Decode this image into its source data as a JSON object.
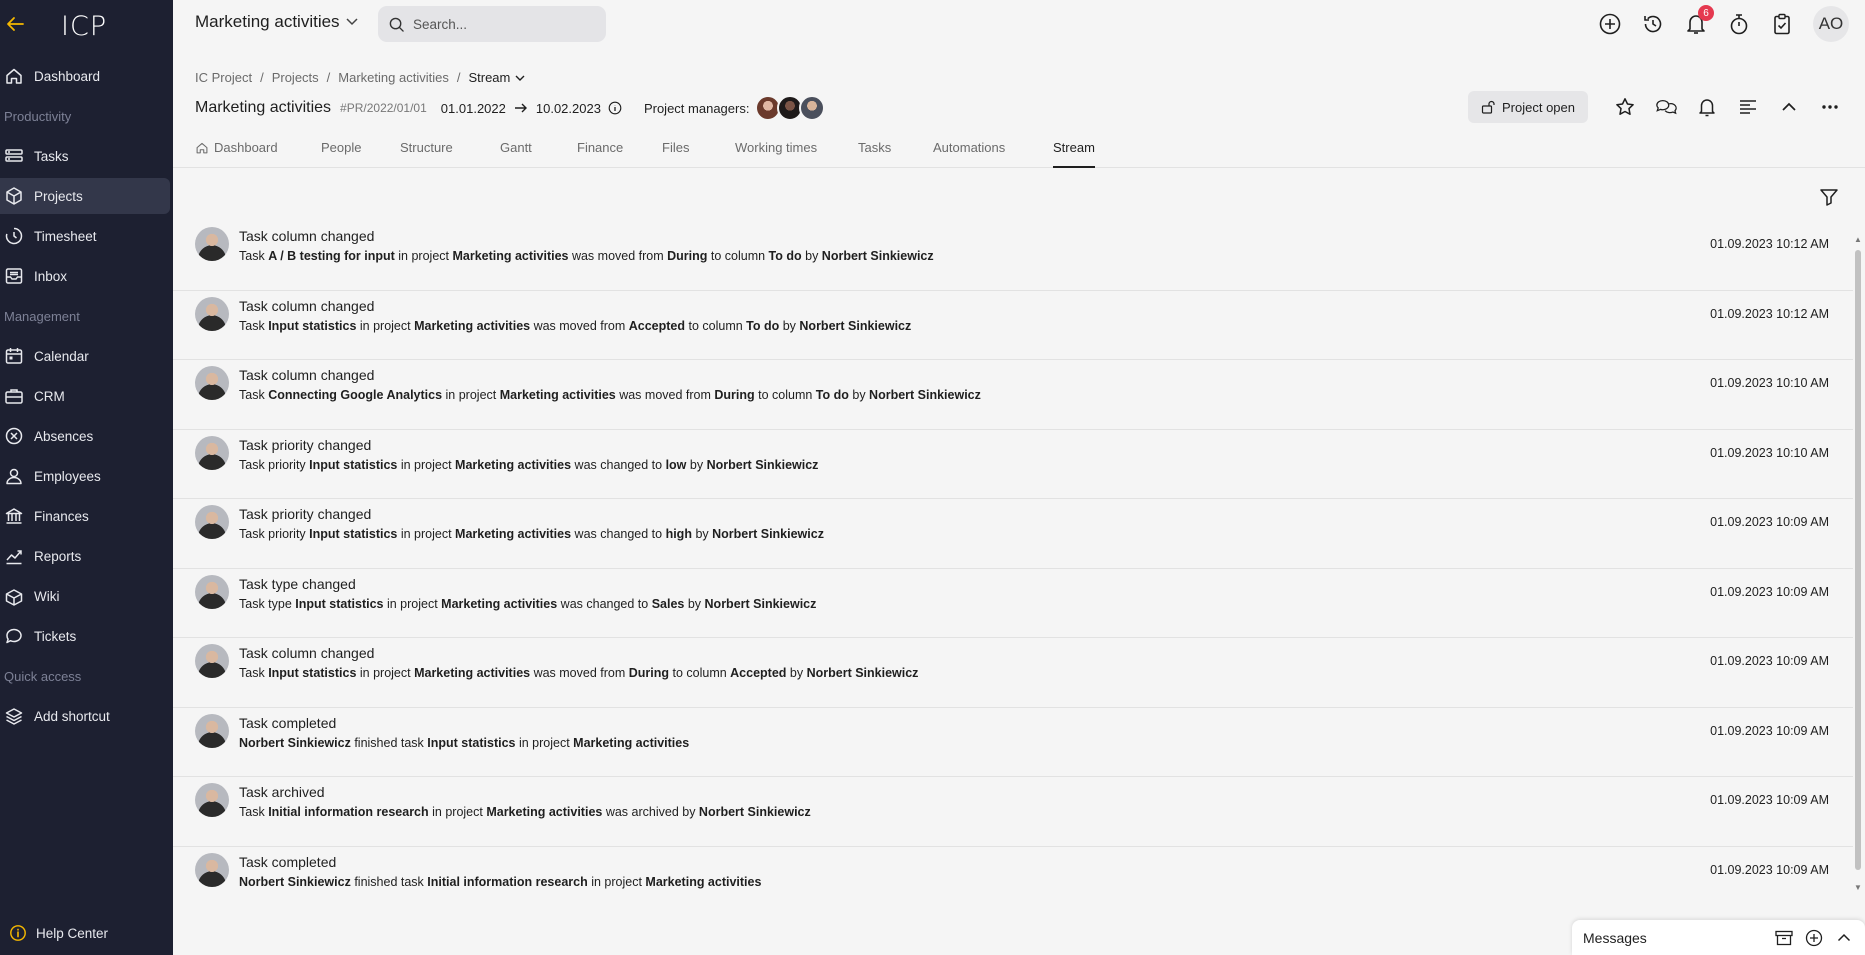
{
  "sidebar": {
    "logo": "ICP",
    "items": [
      {
        "type": "item",
        "label": "Dashboard",
        "icon": "home-icon"
      },
      {
        "type": "section",
        "label": "Productivity"
      },
      {
        "type": "item",
        "label": "Tasks",
        "icon": "tasks-icon"
      },
      {
        "type": "item",
        "label": "Projects",
        "icon": "cube-icon",
        "active": true
      },
      {
        "type": "item",
        "label": "Timesheet",
        "icon": "timesheet-icon"
      },
      {
        "type": "item",
        "label": "Inbox",
        "icon": "inbox-icon"
      },
      {
        "type": "section",
        "label": "Management"
      },
      {
        "type": "item",
        "label": "Calendar",
        "icon": "calendar-icon"
      },
      {
        "type": "item",
        "label": "CRM",
        "icon": "briefcase-icon"
      },
      {
        "type": "item",
        "label": "Absences",
        "icon": "x-circle-icon"
      },
      {
        "type": "item",
        "label": "Employees",
        "icon": "user-icon"
      },
      {
        "type": "item",
        "label": "Finances",
        "icon": "bank-icon"
      },
      {
        "type": "item",
        "label": "Reports",
        "icon": "chart-icon"
      },
      {
        "type": "item",
        "label": "Wiki",
        "icon": "wiki-icon"
      },
      {
        "type": "item",
        "label": "Tickets",
        "icon": "chat-icon"
      },
      {
        "type": "section",
        "label": "Quick access"
      },
      {
        "type": "item",
        "label": "Add shortcut",
        "icon": "layers-icon"
      }
    ],
    "help": "Help Center"
  },
  "topbar": {
    "project_select": "Marketing activities",
    "search_placeholder": "Search...",
    "notification_count": "6",
    "avatar_initials": "AO"
  },
  "breadcrumb": [
    "IC Project",
    "Projects",
    "Marketing activities",
    "Stream"
  ],
  "project": {
    "title": "Marketing activities",
    "code": "#PR/2022/01/01",
    "start_date": "01.01.2022",
    "end_date": "10.02.2023",
    "managers_label": "Project managers:",
    "status_button": "Project open"
  },
  "tabs": [
    {
      "label": "Dashboard",
      "icon": true
    },
    {
      "label": "People"
    },
    {
      "label": "Structure"
    },
    {
      "label": "Gantt"
    },
    {
      "label": "Finance"
    },
    {
      "label": "Files"
    },
    {
      "label": "Working times"
    },
    {
      "label": "Tasks"
    },
    {
      "label": "Automations"
    },
    {
      "label": "Stream",
      "active": true
    }
  ],
  "stream": [
    {
      "title": "Task column changed",
      "time": "01.09.2023 10:12 AM",
      "desc": [
        [
          "Task ",
          false
        ],
        [
          "A / B testing for input",
          true
        ],
        [
          " in project ",
          false
        ],
        [
          "Marketing activities",
          true
        ],
        [
          " was moved from ",
          false
        ],
        [
          "During",
          true
        ],
        [
          " to column ",
          false
        ],
        [
          "To do",
          true
        ],
        [
          " by ",
          false
        ],
        [
          "Norbert Sinkiewicz",
          true
        ]
      ]
    },
    {
      "title": "Task column changed",
      "time": "01.09.2023 10:12 AM",
      "desc": [
        [
          "Task ",
          false
        ],
        [
          "Input statistics",
          true
        ],
        [
          " in project ",
          false
        ],
        [
          "Marketing activities",
          true
        ],
        [
          " was moved from ",
          false
        ],
        [
          "Accepted",
          true
        ],
        [
          " to column ",
          false
        ],
        [
          "To do",
          true
        ],
        [
          " by ",
          false
        ],
        [
          "Norbert Sinkiewicz",
          true
        ]
      ]
    },
    {
      "title": "Task column changed",
      "time": "01.09.2023 10:10 AM",
      "desc": [
        [
          "Task ",
          false
        ],
        [
          "Connecting Google Analytics",
          true
        ],
        [
          " in project ",
          false
        ],
        [
          "Marketing activities",
          true
        ],
        [
          " was moved from ",
          false
        ],
        [
          "During",
          true
        ],
        [
          " to column ",
          false
        ],
        [
          "To do",
          true
        ],
        [
          " by ",
          false
        ],
        [
          "Norbert Sinkiewicz",
          true
        ]
      ]
    },
    {
      "title": "Task priority changed",
      "time": "01.09.2023 10:10 AM",
      "desc": [
        [
          "Task priority ",
          false
        ],
        [
          "Input statistics",
          true
        ],
        [
          " in project ",
          false
        ],
        [
          "Marketing activities",
          true
        ],
        [
          " was changed to ",
          false
        ],
        [
          "low",
          true
        ],
        [
          " by ",
          false
        ],
        [
          "Norbert Sinkiewicz",
          true
        ]
      ]
    },
    {
      "title": "Task priority changed",
      "time": "01.09.2023 10:09 AM",
      "desc": [
        [
          "Task priority ",
          false
        ],
        [
          "Input statistics",
          true
        ],
        [
          " in project ",
          false
        ],
        [
          "Marketing activities",
          true
        ],
        [
          " was changed to ",
          false
        ],
        [
          "high",
          true
        ],
        [
          " by ",
          false
        ],
        [
          "Norbert Sinkiewicz",
          true
        ]
      ]
    },
    {
      "title": "Task type changed",
      "time": "01.09.2023 10:09 AM",
      "desc": [
        [
          "Task type ",
          false
        ],
        [
          "Input statistics",
          true
        ],
        [
          " in project ",
          false
        ],
        [
          "Marketing activities",
          true
        ],
        [
          " was changed to ",
          false
        ],
        [
          "Sales",
          true
        ],
        [
          " by ",
          false
        ],
        [
          "Norbert Sinkiewicz",
          true
        ]
      ]
    },
    {
      "title": "Task column changed",
      "time": "01.09.2023 10:09 AM",
      "desc": [
        [
          "Task ",
          false
        ],
        [
          "Input statistics",
          true
        ],
        [
          " in project ",
          false
        ],
        [
          "Marketing activities",
          true
        ],
        [
          " was moved from ",
          false
        ],
        [
          "During",
          true
        ],
        [
          " to column ",
          false
        ],
        [
          "Accepted",
          true
        ],
        [
          " by ",
          false
        ],
        [
          "Norbert Sinkiewicz",
          true
        ]
      ]
    },
    {
      "title": "Task completed",
      "time": "01.09.2023 10:09 AM",
      "desc": [
        [
          "Norbert Sinkiewicz",
          true
        ],
        [
          " finished task ",
          false
        ],
        [
          "Input statistics",
          true
        ],
        [
          " in project ",
          false
        ],
        [
          "Marketing activities",
          true
        ]
      ]
    },
    {
      "title": "Task archived",
      "time": "01.09.2023 10:09 AM",
      "desc": [
        [
          "Task ",
          false
        ],
        [
          "Initial information research",
          true
        ],
        [
          " in project ",
          false
        ],
        [
          "Marketing activities",
          true
        ],
        [
          " was archived by ",
          false
        ],
        [
          "Norbert Sinkiewicz",
          true
        ]
      ]
    },
    {
      "title": "Task completed",
      "time": "01.09.2023 10:09 AM",
      "desc": [
        [
          "Norbert Sinkiewicz",
          true
        ],
        [
          " finished task ",
          false
        ],
        [
          "Initial information research",
          true
        ],
        [
          " in project ",
          false
        ],
        [
          "Marketing activities",
          true
        ]
      ]
    }
  ],
  "messages": {
    "label": "Messages"
  },
  "colors": {
    "sidebar_bg": "#1d2031",
    "accent_back": "#f5b800",
    "badge": "#e53950",
    "page_bg": "#f5f5f5"
  }
}
